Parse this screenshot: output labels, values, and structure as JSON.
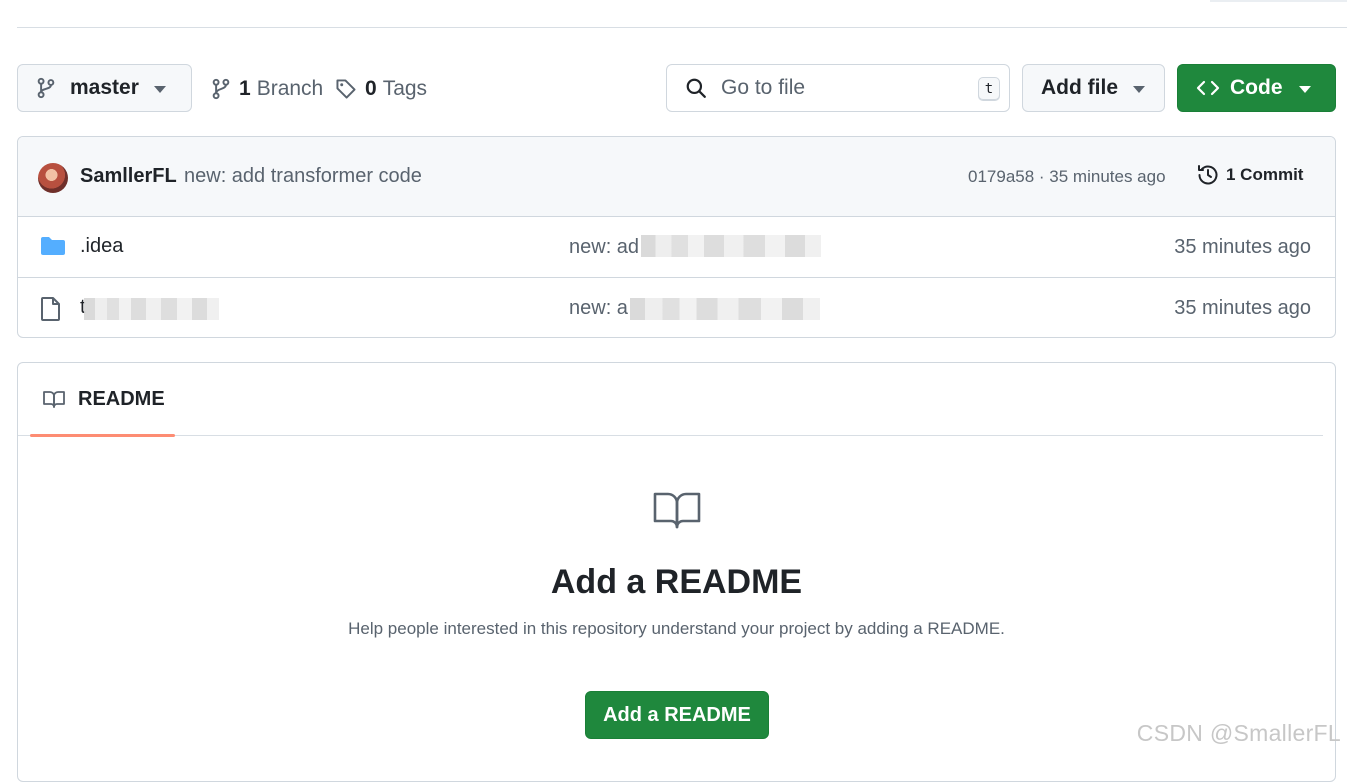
{
  "toolbar": {
    "branch_selector": {
      "label": "master"
    },
    "branches": {
      "count": "1",
      "label": "Branch"
    },
    "tags": {
      "count": "0",
      "label": "Tags"
    },
    "goto_file": {
      "placeholder": "Go to file",
      "shortcut": "t"
    },
    "add_file_label": "Add file",
    "code_label": "Code"
  },
  "latest_commit": {
    "author": "SamllerFL",
    "message": "new: add transformer code",
    "hash_time": "0179a58 · 35 minutes ago",
    "commit_count_label": "1 Commit"
  },
  "files": [
    {
      "type": "folder",
      "name": ".idea",
      "message": "new: ad",
      "time": "35 minutes ago"
    },
    {
      "type": "file",
      "name": "t",
      "message": "new: a",
      "time": "35 minutes ago"
    }
  ],
  "readme": {
    "tab_label": "README",
    "title": "Add a README",
    "description": "Help people interested in this repository understand your project by adding a README.",
    "button_label": "Add a README"
  },
  "watermark": "CSDN @SmallerFL",
  "colors": {
    "primary_green": "#1f883d",
    "folder_blue": "#54aeff",
    "tab_underline": "#fd8c73",
    "border": "#d0d7de",
    "muted_text": "#59636e"
  }
}
